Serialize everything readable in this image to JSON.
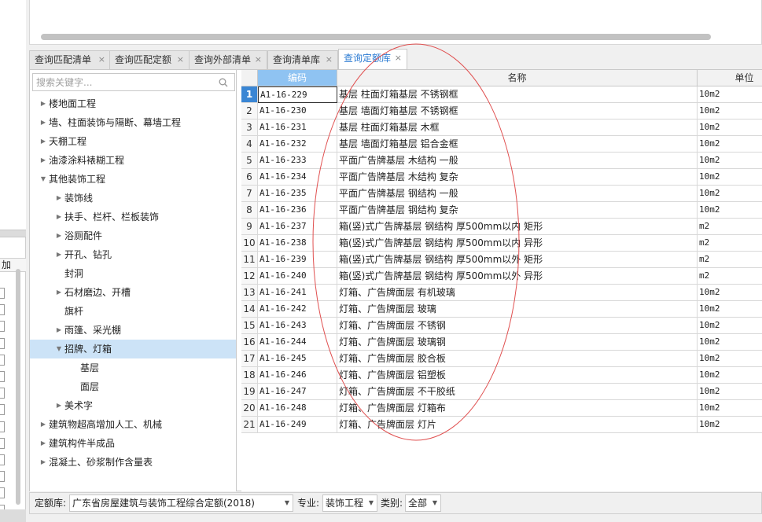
{
  "left_panel": {
    "header_label": "加"
  },
  "tabs": [
    {
      "label": "查询匹配清单",
      "close": "×"
    },
    {
      "label": "查询匹配定额",
      "close": "×"
    },
    {
      "label": "查询外部清单",
      "close": "×"
    },
    {
      "label": "查询清单库",
      "close": "×"
    },
    {
      "label": "查询定额库",
      "close": "×",
      "active": true
    }
  ],
  "search": {
    "placeholder": "搜索关键字..."
  },
  "tree": [
    {
      "label": "楼地面工程",
      "level": 0,
      "arrow": "right"
    },
    {
      "label": "墙、柱面装饰与隔断、幕墙工程",
      "level": 0,
      "arrow": "right"
    },
    {
      "label": "天棚工程",
      "level": 0,
      "arrow": "right"
    },
    {
      "label": "油漆涂料裱糊工程",
      "level": 0,
      "arrow": "right"
    },
    {
      "label": "其他装饰工程",
      "level": 0,
      "arrow": "down"
    },
    {
      "label": "装饰线",
      "level": 1,
      "arrow": "right"
    },
    {
      "label": "扶手、栏杆、栏板装饰",
      "level": 1,
      "arrow": "right"
    },
    {
      "label": "浴厕配件",
      "level": 1,
      "arrow": "right"
    },
    {
      "label": "开孔、钻孔",
      "level": 1,
      "arrow": "right"
    },
    {
      "label": "封洞",
      "level": 1,
      "arrow": ""
    },
    {
      "label": "石材磨边、开槽",
      "level": 1,
      "arrow": "right"
    },
    {
      "label": "旗杆",
      "level": 1,
      "arrow": ""
    },
    {
      "label": "雨篷、采光棚",
      "level": 1,
      "arrow": "right"
    },
    {
      "label": "招牌、灯箱",
      "level": 1,
      "arrow": "down",
      "selected": true
    },
    {
      "label": "基层",
      "level": 2,
      "arrow": ""
    },
    {
      "label": "面层",
      "level": 2,
      "arrow": ""
    },
    {
      "label": "美术字",
      "level": 1,
      "arrow": "right"
    },
    {
      "label": "建筑物超高增加人工、机械",
      "level": 0,
      "arrow": "right"
    },
    {
      "label": "建筑构件半成品",
      "level": 0,
      "arrow": "right"
    },
    {
      "label": "混凝土、砂浆制作含量表",
      "level": 0,
      "arrow": "right"
    }
  ],
  "grid": {
    "columns": {
      "code": "编码",
      "name": "名称",
      "unit": "单位"
    },
    "rows": [
      {
        "no": "1",
        "code": "A1-16-229",
        "name": "基层 柱面灯箱基层 不锈钢框",
        "unit": "10m2"
      },
      {
        "no": "2",
        "code": "A1-16-230",
        "name": "基层 墙面灯箱基层 不锈钢框",
        "unit": "10m2"
      },
      {
        "no": "3",
        "code": "A1-16-231",
        "name": "基层 柱面灯箱基层 木框",
        "unit": "10m2"
      },
      {
        "no": "4",
        "code": "A1-16-232",
        "name": "基层 墙面灯箱基层 铝合金框",
        "unit": "10m2"
      },
      {
        "no": "5",
        "code": "A1-16-233",
        "name": "平面广告牌基层 木结构 一般",
        "unit": "10m2"
      },
      {
        "no": "6",
        "code": "A1-16-234",
        "name": "平面广告牌基层 木结构 复杂",
        "unit": "10m2"
      },
      {
        "no": "7",
        "code": "A1-16-235",
        "name": "平面广告牌基层 钢结构 一般",
        "unit": "10m2"
      },
      {
        "no": "8",
        "code": "A1-16-236",
        "name": "平面广告牌基层 钢结构 复杂",
        "unit": "10m2"
      },
      {
        "no": "9",
        "code": "A1-16-237",
        "name": "箱(竖)式广告牌基层 钢结构 厚500mm以内 矩形",
        "unit": "m2"
      },
      {
        "no": "10",
        "code": "A1-16-238",
        "name": "箱(竖)式广告牌基层 钢结构 厚500mm以内 异形",
        "unit": "m2"
      },
      {
        "no": "11",
        "code": "A1-16-239",
        "name": "箱(竖)式广告牌基层 钢结构 厚500mm以外 矩形",
        "unit": "m2"
      },
      {
        "no": "12",
        "code": "A1-16-240",
        "name": "箱(竖)式广告牌基层 钢结构 厚500mm以外 异形",
        "unit": "m2"
      },
      {
        "no": "13",
        "code": "A1-16-241",
        "name": "灯箱、广告牌面层 有机玻璃",
        "unit": "10m2"
      },
      {
        "no": "14",
        "code": "A1-16-242",
        "name": "灯箱、广告牌面层 玻璃",
        "unit": "10m2"
      },
      {
        "no": "15",
        "code": "A1-16-243",
        "name": "灯箱、广告牌面层 不锈钢",
        "unit": "10m2"
      },
      {
        "no": "16",
        "code": "A1-16-244",
        "name": "灯箱、广告牌面层 玻璃钢",
        "unit": "10m2"
      },
      {
        "no": "17",
        "code": "A1-16-245",
        "name": "灯箱、广告牌面层 胶合板",
        "unit": "10m2"
      },
      {
        "no": "18",
        "code": "A1-16-246",
        "name": "灯箱、广告牌面层 铝塑板",
        "unit": "10m2"
      },
      {
        "no": "19",
        "code": "A1-16-247",
        "name": "灯箱、广告牌面层 不干胶纸",
        "unit": "10m2"
      },
      {
        "no": "20",
        "code": "A1-16-248",
        "name": "灯箱、广告牌面层 灯箱布",
        "unit": "10m2"
      },
      {
        "no": "21",
        "code": "A1-16-249",
        "name": "灯箱、广告牌面层 灯片",
        "unit": "10m2"
      }
    ]
  },
  "footer": {
    "quota_lib_label": "定额库:",
    "quota_lib_value": "广东省房屋建筑与装饰工程综合定额(2018)",
    "specialty_label": "专业:",
    "specialty_value": "装饰工程",
    "category_label": "类别:",
    "category_value": "全部"
  },
  "colors": {
    "accent": "#2b7bd3",
    "selected_row_bg": "#cce3f7",
    "header_code_bg": "#8fc3f2",
    "annotation_ellipse": "#e05050"
  }
}
